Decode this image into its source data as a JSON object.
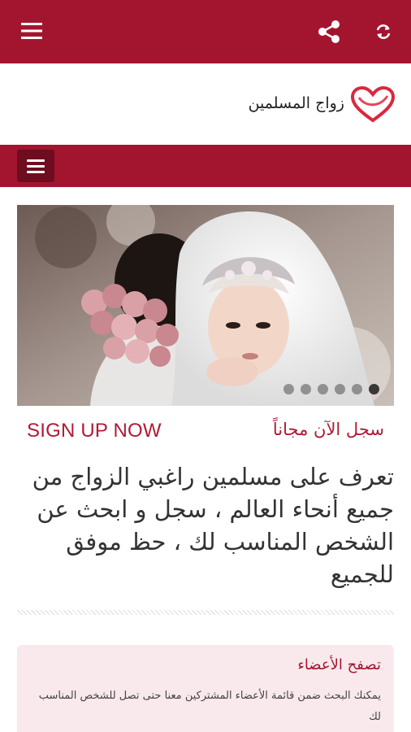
{
  "topbar": {
    "menu_icon": "hamburger-menu-icon",
    "share_icon": "share-icon",
    "refresh_icon": "refresh-icon"
  },
  "brand": {
    "name": "زواج المسلمين",
    "logo_icon": "heart-logo-icon"
  },
  "navbar": {
    "toggle_icon": "hamburger-menu-icon"
  },
  "slider": {
    "slide_count": 6,
    "active_index": 5
  },
  "signup": {
    "english_label": "SIGN UP NOW",
    "arabic_label": "سجل الآن مجاناً"
  },
  "headline": "تعرف على مسلمين راغبي الزواج من جميع أنحاء العالم ، سجل و ابحث عن الشخص المناسب لك ، حظ موفق للجميع",
  "members_card": {
    "title": "تصفح الأعضاء",
    "description": "يمكنك البحث ضمن قائمة الأعضاء المشتركين معنا حتى تصل للشخص المناسب لك"
  },
  "colors": {
    "brand": "#a3152f",
    "brand_dark": "#6e0d1f",
    "accent_text": "#b01a35",
    "card_bg": "#f9e9ec"
  }
}
